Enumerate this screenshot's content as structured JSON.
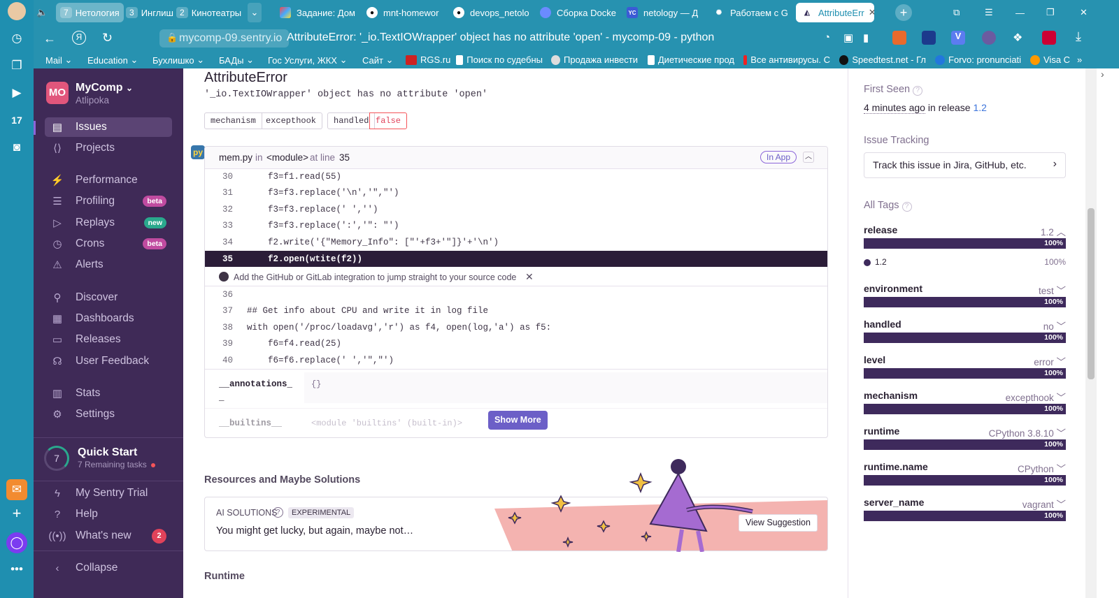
{
  "tabs": {
    "groups": [
      {
        "num": "7",
        "label": "Нетология"
      },
      {
        "num": "3",
        "label": "Инглиш"
      },
      {
        "num": "2",
        "label": "Кинотеатры"
      }
    ],
    "items": [
      {
        "label": "Задание: Дом",
        "icon": "multicolor-icon"
      },
      {
        "label": "mnt-homewor",
        "icon": "github-icon"
      },
      {
        "label": "devops_netolo",
        "icon": "github-icon"
      },
      {
        "label": "Сборка Docke",
        "icon": "compass-icon"
      },
      {
        "label": "netology — Д",
        "icon": "yc-icon"
      },
      {
        "label": "Работаем с G",
        "icon": "sentry-icon"
      },
      {
        "label": "AttributeErr",
        "icon": "sentry-icon"
      }
    ]
  },
  "addressbar": {
    "url": "mycomp-09.sentry.io",
    "title": "AttributeError: '_io.TextIOWrapper' object has no attribute 'open' - mycomp-09 - python"
  },
  "bookmarks": [
    "Mail",
    "Education",
    "Бухлишко",
    "БАДы",
    "Гос Услуги, ЖКХ",
    "Сайт",
    "RGS.ru",
    "Поиск по судебны",
    "Продажа инвести",
    "Диетические прод",
    "Все антивирусы. С",
    "Speedtest.net - Гл",
    "Forvo: pronunciati",
    "Visa C"
  ],
  "sidebar": {
    "org_avatar": "MO",
    "org_name": "MyComp",
    "org_user": "Atlipoka",
    "items": [
      {
        "label": "Issues",
        "icon": "issues-icon"
      },
      {
        "label": "Projects",
        "icon": "projects-icon"
      },
      {
        "label": "Performance",
        "icon": "performance-icon"
      },
      {
        "label": "Profiling",
        "icon": "profiling-icon",
        "badge": "beta"
      },
      {
        "label": "Replays",
        "icon": "replays-icon",
        "badge": "new"
      },
      {
        "label": "Crons",
        "icon": "crons-icon",
        "badge": "beta"
      },
      {
        "label": "Alerts",
        "icon": "alerts-icon"
      },
      {
        "label": "Discover",
        "icon": "discover-icon"
      },
      {
        "label": "Dashboards",
        "icon": "dashboards-icon"
      },
      {
        "label": "Releases",
        "icon": "releases-icon"
      },
      {
        "label": "User Feedback",
        "icon": "feedback-icon"
      },
      {
        "label": "Stats",
        "icon": "stats-icon"
      },
      {
        "label": "Settings",
        "icon": "settings-icon"
      }
    ],
    "quickstart": {
      "num": "7",
      "title": "Quick Start",
      "sub": "7 Remaining tasks"
    },
    "bottom": [
      {
        "label": "My Sentry Trial",
        "icon": "lightning-icon"
      },
      {
        "label": "Help",
        "icon": "help-icon"
      },
      {
        "label": "What's new",
        "icon": "broadcast-icon",
        "badge": "2"
      }
    ],
    "collapse": "Collapse"
  },
  "error": {
    "title": "AttributeError",
    "message": "'_io.TextIOWrapper' object has no attribute 'open'",
    "tags": [
      "mechanism",
      "excepthook",
      "handled",
      "false"
    ]
  },
  "frame": {
    "file": "mem.py",
    "in": "in",
    "module": "<module>",
    "at_line": "at line",
    "line": "35",
    "in_app": "In App",
    "lines_before": [
      {
        "n": "30",
        "code": "    f3=f1.read(55)"
      },
      {
        "n": "31",
        "code": "    f3=f3.replace('\\n','\",\"')"
      },
      {
        "n": "32",
        "code": "    f3=f3.replace(' ','')"
      },
      {
        "n": "33",
        "code": "    f3=f3.replace(':','\": \"')"
      },
      {
        "n": "34",
        "code": "    f2.write('{\"Memory_Info\": [\"'+f3+'\"]}'+'\\n')"
      },
      {
        "n": "35",
        "code": "    f2.open(wtite(f2))"
      }
    ],
    "integration_hint": "Add the GitHub or GitLab integration to jump straight to your source code",
    "lines_after": [
      {
        "n": "36",
        "code": ""
      },
      {
        "n": "37",
        "code": "## Get info about CPU and write it in log file"
      },
      {
        "n": "38",
        "code": "with open('/proc/loadavg','r') as f4, open(log,'a') as f5:"
      },
      {
        "n": "39",
        "code": "    f6=f4.read(25)"
      },
      {
        "n": "40",
        "code": "    f6=f6.replace(' ','\",\"')"
      }
    ],
    "vars": [
      {
        "name": "__annotations__",
        "value": "{}"
      },
      {
        "name": "__builtins__",
        "value": "<module 'builtins' (built-in)>"
      }
    ],
    "show_more": "Show More"
  },
  "resources": {
    "heading": "Resources and Maybe Solutions",
    "ai_label": "AI SOLUTIONS",
    "experimental": "EXPERIMENTAL",
    "text": "You might get lucky, but again, maybe not…",
    "button": "View Suggestion"
  },
  "runtime_heading": "Runtime",
  "right": {
    "first_seen_label": "First Seen",
    "first_seen_time": "4 minutes ago",
    "in_release": "in release",
    "release": "1.2",
    "issue_tracking_label": "Issue Tracking",
    "track_text": "Track this issue in Jira, GitHub, etc.",
    "all_tags_label": "All Tags",
    "tags": [
      {
        "name": "release",
        "value": "1.2",
        "pct": "100%"
      },
      {
        "name": "environment",
        "value": "test",
        "pct": "100%"
      },
      {
        "name": "handled",
        "value": "no",
        "pct": "100%"
      },
      {
        "name": "level",
        "value": "error",
        "pct": "100%"
      },
      {
        "name": "mechanism",
        "value": "excepthook",
        "pct": "100%"
      },
      {
        "name": "runtime",
        "value": "CPython 3.8.10",
        "pct": "100%"
      },
      {
        "name": "runtime.name",
        "value": "CPython",
        "pct": "100%"
      },
      {
        "name": "server_name",
        "value": "vagrant",
        "pct": "100%"
      }
    ],
    "release_detail": {
      "value": "1.2",
      "pct": "100%"
    }
  },
  "colors": {
    "accent": "#6c5fc7",
    "sidebar": "#3f2a57",
    "browser": "#2792b0",
    "bar": "#3e2a5c",
    "danger": "#f55459"
  }
}
